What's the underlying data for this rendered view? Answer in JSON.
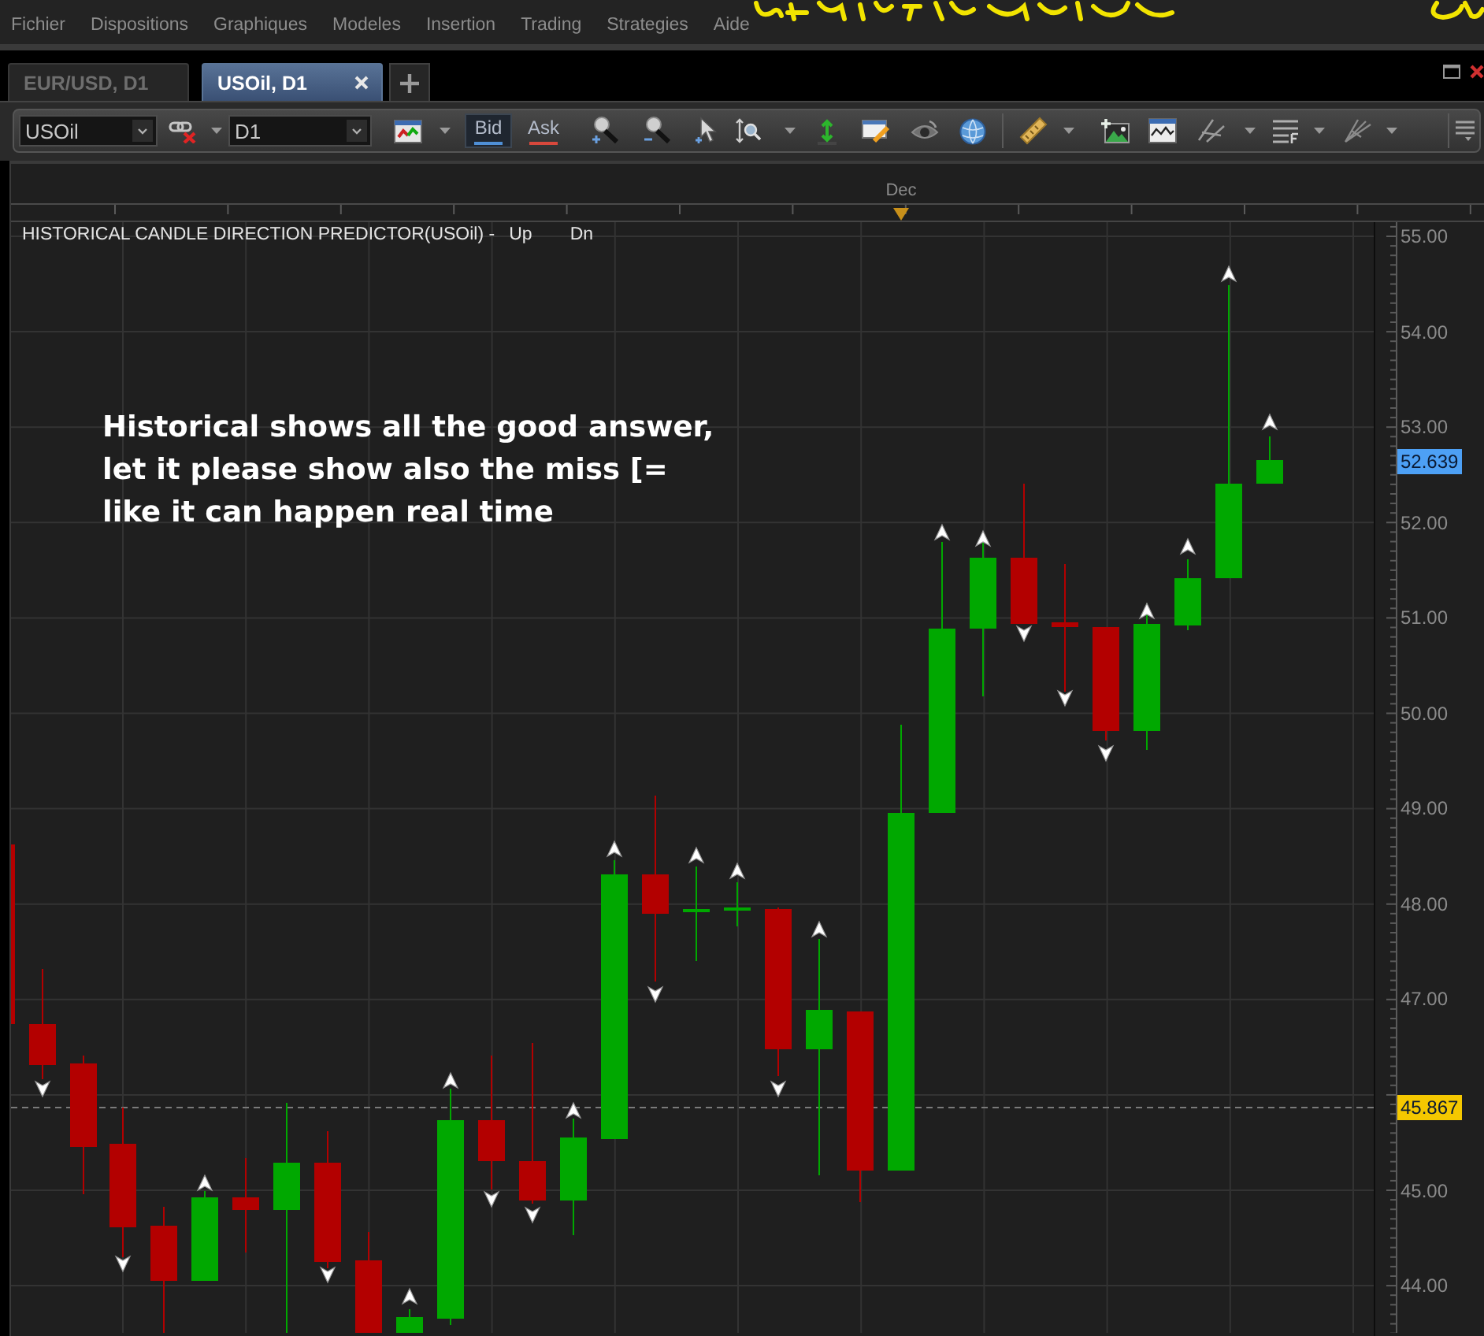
{
  "menu": {
    "items": [
      "Fichier",
      "Dispositions",
      "Graphiques",
      "Modeles",
      "Insertion",
      "Trading",
      "Strategies",
      "Aide"
    ]
  },
  "tabs": [
    {
      "label": "EUR/USD, D1",
      "selected": false
    },
    {
      "label": "USOil, D1",
      "selected": true
    }
  ],
  "toolbar": {
    "symbol": {
      "value": "USOil"
    },
    "timeframe": {
      "value": "D1"
    },
    "price_sides": [
      {
        "label": "Bid",
        "selected": true,
        "color": "#4f8fd6"
      },
      {
        "label": "Ask",
        "selected": false,
        "color": "#d8483c"
      }
    ]
  },
  "chart": {
    "time_axis": {
      "labels": [
        "Dec"
      ]
    },
    "indicator": {
      "title": "HISTORICAL CANDLE DIRECTION PREDICTOR(USOil) -",
      "legend": [
        "Up",
        "Dn"
      ]
    },
    "note": "Historical shows all the good answer,\nlet it please show also the miss [=\nlike it can happen real time",
    "price_axis": {
      "ticks": [
        "55.00",
        "54.00",
        "53.00",
        "52.00",
        "51.00",
        "50.00",
        "49.00",
        "48.00",
        "47.00",
        "45.00",
        "44.00"
      ],
      "badges": [
        {
          "text": "52.639",
          "color": "#4da0f5"
        },
        {
          "text": "45.867",
          "color": "#f5c800"
        }
      ]
    }
  }
}
